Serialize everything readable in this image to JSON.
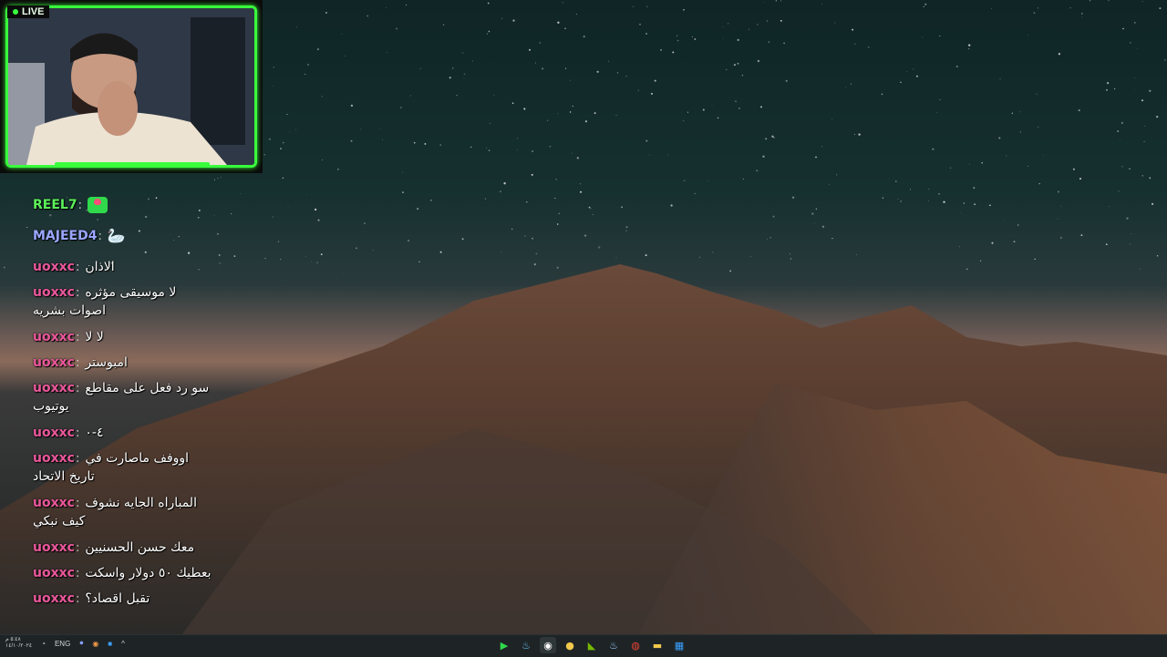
{
  "overlay": {
    "live_label": "LIVE"
  },
  "chat": {
    "messages": [
      {
        "user": "REEL7",
        "text": "",
        "line2": "",
        "emote": "heart-emote",
        "user_color": "#5cf25a"
      },
      {
        "user": "MAJEED4",
        "text": "",
        "line2": "",
        "emote": "goose-emote",
        "user_color": "#9aa6ff"
      },
      {
        "user": "uoxxc",
        "text": "الاذان",
        "line2": "",
        "user_color": "#e9579a"
      },
      {
        "user": "uoxxc",
        "text": "لا موسيقى مؤثره",
        "line2": "اصوات بشريه",
        "user_color": "#e9579a"
      },
      {
        "user": "uoxxc",
        "text": "لا لا",
        "line2": "",
        "user_color": "#e9579a"
      },
      {
        "user": "uoxxc",
        "text": "امبوستر",
        "line2": "",
        "user_color": "#e9579a"
      },
      {
        "user": "uoxxc",
        "text": "سو رد فعل على مقاطع",
        "line2": "يوتيوب",
        "user_color": "#e9579a"
      },
      {
        "user": "uoxxc",
        "text": "٤-٠",
        "line2": "",
        "user_color": "#e9579a"
      },
      {
        "user": "uoxxc",
        "text": "اووفف ماصارت في",
        "line2": "تاريخ الاتحاد",
        "user_color": "#e9579a"
      },
      {
        "user": "uoxxc",
        "text": "المباراه الجايه نشوف",
        "line2": "كيف نبكي",
        "user_color": "#e9579a"
      },
      {
        "user": "uoxxc",
        "text": "معك حسن الحسنيين",
        "line2": "",
        "user_color": "#e9579a"
      },
      {
        "user": "uoxxc",
        "text": "بعطيك ٥٠ دولار واسكت",
        "line2": "",
        "user_color": "#e9579a"
      },
      {
        "user": "uoxxc",
        "text": "تقبل اقصاد؟",
        "line2": "",
        "user_color": "#e9579a"
      }
    ],
    "separator": ":"
  },
  "taskbar": {
    "clock_time": "٥:٤٨ م",
    "clock_date": "١٤/١٠/٢٠٢٤",
    "language": "ENG",
    "apps": [
      {
        "name": "media-player-icon",
        "glyph": "▶",
        "color": "#2fd94b"
      },
      {
        "name": "steam-icon",
        "glyph": "♨",
        "color": "#66c0f4"
      },
      {
        "name": "obs-icon",
        "glyph": "◉",
        "color": "#ffffff"
      },
      {
        "name": "folder-yellow-icon",
        "glyph": "●",
        "color": "#f2c94c"
      },
      {
        "name": "nvidia-icon",
        "glyph": "◣",
        "color": "#76b900"
      },
      {
        "name": "steam-alt-icon",
        "glyph": "♨",
        "color": "#9ecbff"
      },
      {
        "name": "chrome-icon",
        "glyph": "◍",
        "color": "#ea4335"
      },
      {
        "name": "file-explorer-icon",
        "glyph": "▬",
        "color": "#f2c94c"
      },
      {
        "name": "windows-icon",
        "glyph": "▦",
        "color": "#3aa0ff"
      }
    ]
  }
}
